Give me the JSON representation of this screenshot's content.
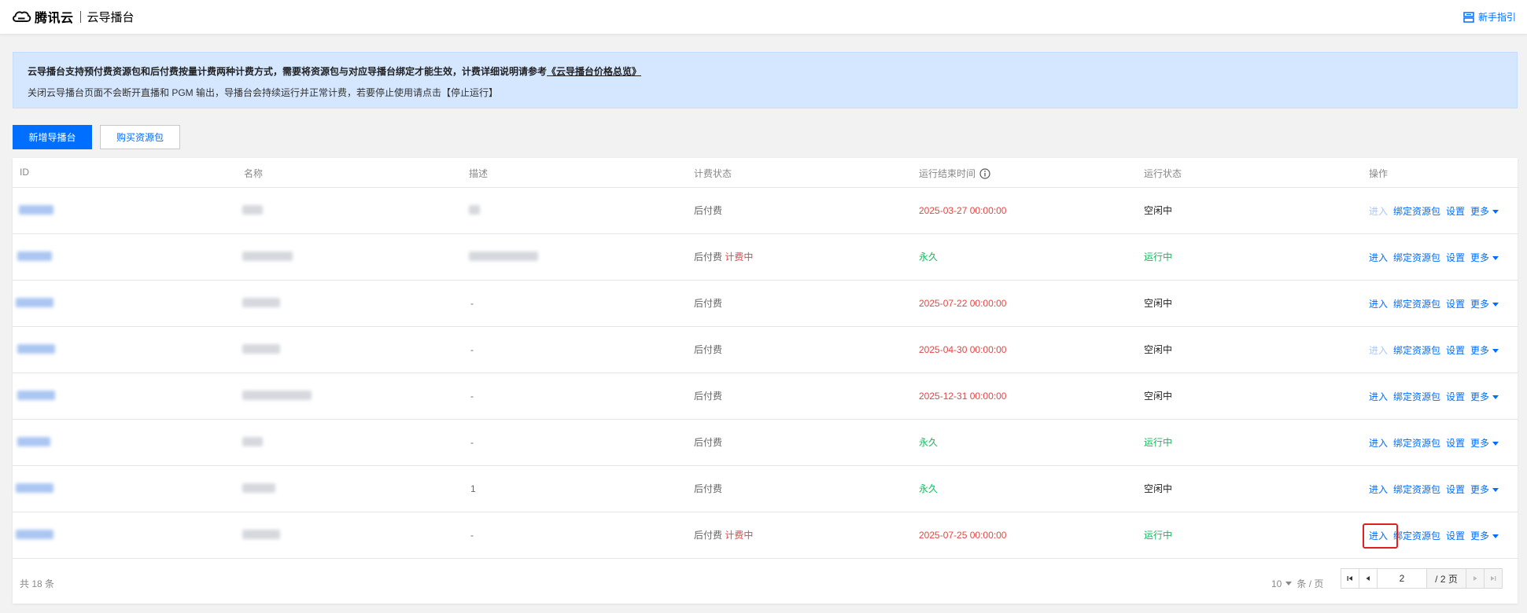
{
  "header": {
    "brand": "腾讯云",
    "product": "云导播台",
    "guide_label": "新手指引"
  },
  "notice": {
    "line1_prefix": "云导播台支持预付费资源包和后付费按量计费两种计费方式，需要将资源包与对应导播台绑定才能生效，计费详细说明请参考",
    "line1_link": "《云导播台价格总览》",
    "line2": "关闭云导播台页面不会断开直播和 PGM 输出，导播台会持续运行并正常计费，若要停止使用请点击【停止运行】"
  },
  "toolbar": {
    "create_label": "新增导播台",
    "buy_label": "购买资源包"
  },
  "table": {
    "columns": [
      "ID",
      "名称",
      "描述",
      "计费状态",
      "运行结束时间",
      "运行状态",
      "操作"
    ],
    "rows": [
      {
        "desc": "",
        "billing": "后付费",
        "billing_tag": "",
        "end_time": "2025-03-27 00:00:00",
        "end_color": "red",
        "status": "空闲中",
        "status_color": "dark",
        "enter_disabled": true
      },
      {
        "desc": "",
        "billing": "后付费",
        "billing_tag": "计费中",
        "end_time": "永久",
        "end_color": "green",
        "status": "运行中",
        "status_color": "green",
        "enter_disabled": false
      },
      {
        "desc": "-",
        "billing": "后付费",
        "billing_tag": "",
        "end_time": "2025-07-22 00:00:00",
        "end_color": "red",
        "status": "空闲中",
        "status_color": "dark",
        "enter_disabled": false
      },
      {
        "desc": "-",
        "billing": "后付费",
        "billing_tag": "",
        "end_time": "2025-04-30 00:00:00",
        "end_color": "red",
        "status": "空闲中",
        "status_color": "dark",
        "enter_disabled": true
      },
      {
        "desc": "-",
        "billing": "后付费",
        "billing_tag": "",
        "end_time": "2025-12-31 00:00:00",
        "end_color": "red",
        "status": "空闲中",
        "status_color": "dark",
        "enter_disabled": false
      },
      {
        "desc": "-",
        "billing": "后付费",
        "billing_tag": "",
        "end_time": "永久",
        "end_color": "green",
        "status": "运行中",
        "status_color": "green",
        "enter_disabled": false
      },
      {
        "desc": "1",
        "billing": "后付费",
        "billing_tag": "",
        "end_time": "永久",
        "end_color": "green",
        "status": "空闲中",
        "status_color": "dark",
        "enter_disabled": false
      },
      {
        "desc": "-",
        "billing": "后付费",
        "billing_tag": "计费中",
        "end_time": "2025-07-25 00:00:00",
        "end_color": "red",
        "status": "运行中",
        "status_color": "green",
        "enter_disabled": false,
        "highlight": true
      }
    ],
    "ops": {
      "enter": "进入",
      "bind": "绑定资源包",
      "settings": "设置",
      "more": "更多"
    }
  },
  "footer": {
    "total": "共 18 条",
    "page_size": "10",
    "page_size_unit": "条 / 页",
    "current_page": "2",
    "total_pages": "/ 2 页"
  },
  "colors": {
    "accent": "#006eff",
    "red": "#e54545",
    "green": "#0abf5b",
    "notice_bg": "#d5e7ff"
  }
}
